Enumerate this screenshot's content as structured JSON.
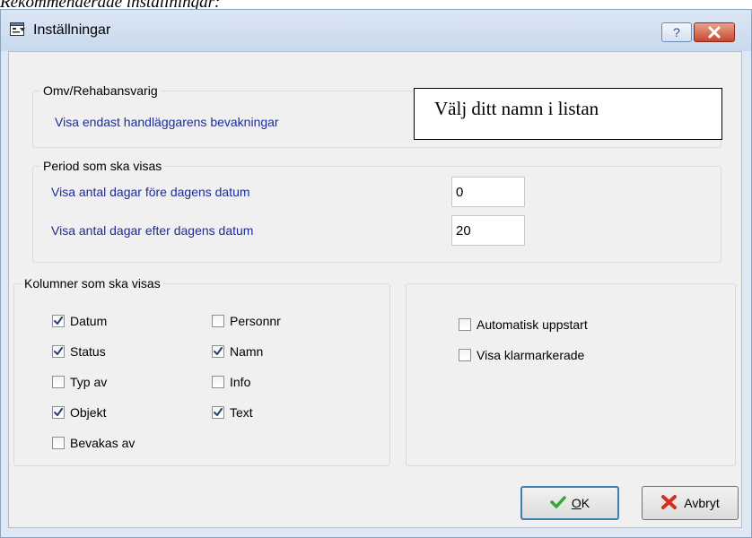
{
  "caption": "Rekommenderade inställningar:",
  "window": {
    "title": "Inställningar",
    "help_label": "?"
  },
  "group_responsible": {
    "legend": "Omv/Rehabansvarig",
    "checkbox_label": "Visa endast handläggarens bevakningar",
    "note": "Välj ditt namn i listan"
  },
  "group_period": {
    "legend": "Period som ska visas",
    "before_label": "Visa antal dagar före dagens datum",
    "before_value": "0",
    "after_label": "Visa antal dagar efter dagens datum",
    "after_value": "20"
  },
  "group_columns": {
    "legend": "Kolumner som ska visas",
    "items": [
      {
        "label": "Datum",
        "checked": true
      },
      {
        "label": "Status",
        "checked": true
      },
      {
        "label": "Typ av",
        "checked": false
      },
      {
        "label": "Objekt",
        "checked": true
      },
      {
        "label": "Bevakas av",
        "checked": false
      },
      {
        "label": "Personnr",
        "checked": false
      },
      {
        "label": "Namn",
        "checked": true
      },
      {
        "label": "Info",
        "checked": false
      },
      {
        "label": "Text",
        "checked": true
      }
    ]
  },
  "group_options": {
    "items": [
      {
        "label": "Automatisk uppstart",
        "checked": false
      },
      {
        "label": "Visa klarmarkerade",
        "checked": false
      }
    ]
  },
  "buttons": {
    "ok_label": "OK",
    "cancel_label": "Avbryt"
  },
  "colors": {
    "label_blue": "#1c2c9c",
    "ok_icon": "#3aa53a",
    "cancel_icon": "#d2321e",
    "close_button": "#c7472f"
  }
}
